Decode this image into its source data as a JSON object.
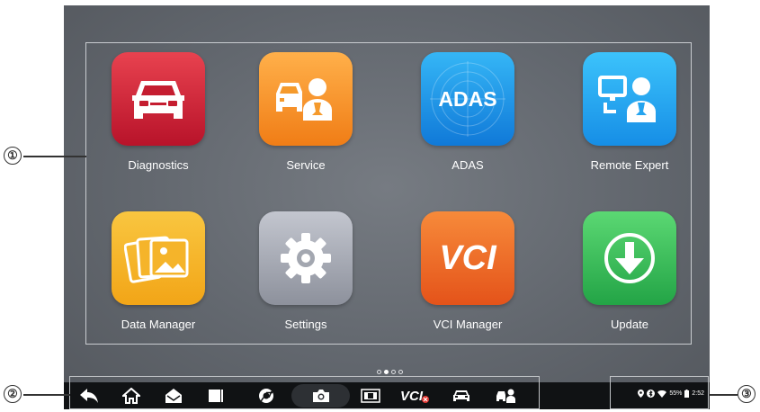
{
  "apps": [
    {
      "label": "Diagnostics",
      "icon": "car-front-icon",
      "color": "#d62a3c"
    },
    {
      "label": "Service",
      "icon": "car-mechanic-icon",
      "color": "#f59a2c"
    },
    {
      "label": "ADAS",
      "icon": "adas-icon",
      "color": "#1f97e6",
      "icon_text": "ADAS"
    },
    {
      "label": "Remote Expert",
      "icon": "remote-expert-icon",
      "color": "#25a4ef"
    },
    {
      "label": "Data Manager",
      "icon": "data-manager-icon",
      "color": "#f4b62a"
    },
    {
      "label": "Settings",
      "icon": "gear-icon",
      "color": "#a8abb4"
    },
    {
      "label": "VCI Manager",
      "icon": "vci-icon",
      "color": "#ee6e28",
      "icon_text": "VCI"
    },
    {
      "label": "Update",
      "icon": "download-arrow-icon",
      "color": "#3cc05c"
    }
  ],
  "taskbar": {
    "icons": [
      "back-icon",
      "home-icon",
      "mail-icon",
      "recent-apps-icon",
      "chrome-icon",
      "camera-icon",
      "screen-record-icon",
      "vci-status-icon",
      "car-icon",
      "service-icon"
    ],
    "vci_label": "VCI"
  },
  "status_bar": {
    "battery": "55%",
    "time": "2:52",
    "icons": [
      "location-icon",
      "bluetooth-icon",
      "wifi-icon",
      "battery-icon"
    ]
  },
  "page_indicator": {
    "count": 4,
    "active": 1
  },
  "callouts": [
    "①",
    "②",
    "③"
  ]
}
